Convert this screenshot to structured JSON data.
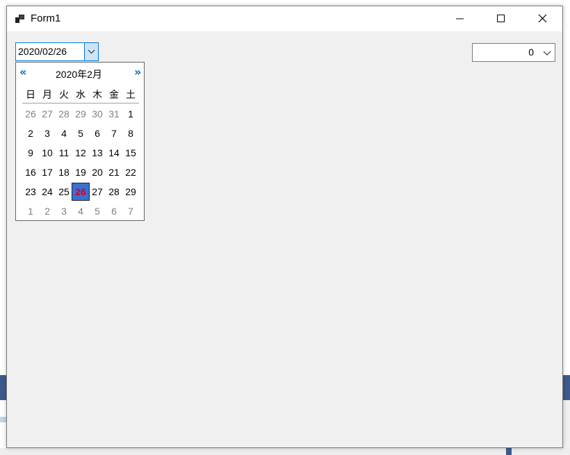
{
  "window": {
    "title": "Form1"
  },
  "date_picker": {
    "value": "2020/02/26"
  },
  "calendar": {
    "prev_label": "«",
    "next_label": "»",
    "month_label": "2020年2月",
    "weekdays": [
      "日",
      "月",
      "火",
      "水",
      "木",
      "金",
      "土"
    ],
    "weeks": [
      [
        "26",
        "27",
        "28",
        "29",
        "30",
        "31",
        "1"
      ],
      [
        "2",
        "3",
        "4",
        "5",
        "6",
        "7",
        "8"
      ],
      [
        "9",
        "10",
        "11",
        "12",
        "13",
        "14",
        "15"
      ],
      [
        "16",
        "17",
        "18",
        "19",
        "20",
        "21",
        "22"
      ],
      [
        "23",
        "24",
        "25",
        "26",
        "27",
        "28",
        "29"
      ],
      [
        "1",
        "2",
        "3",
        "4",
        "5",
        "6",
        "7"
      ]
    ],
    "selected_label": "26"
  },
  "numeric_combo": {
    "value": "0"
  },
  "colors": {
    "accent": "#0078d7",
    "selected_day": "#3b6fd1",
    "dim_text": "#808080"
  }
}
